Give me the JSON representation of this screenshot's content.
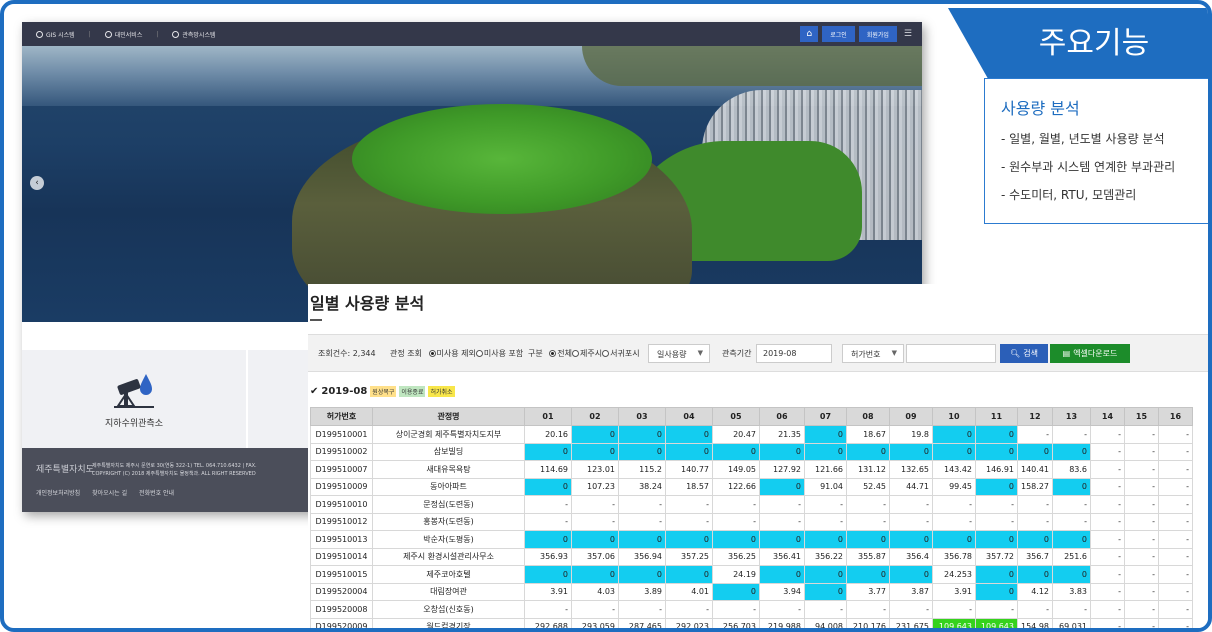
{
  "site": {
    "topbar": {
      "menu": [
        "GIS 시스템",
        "대민서비스",
        "관측망시스템"
      ],
      "login": "로그인",
      "signup": "회원가입"
    },
    "quick_card_label": "지하수위관측소",
    "footer": {
      "logo": "제주특별자치도",
      "info_line1": "제주특별자치도 제주시 문연로 30(연동 322-1) TEL. 064.710.6432 | FAX.",
      "info_line2": "COPYRIGHT (C) 2018 제주특별자치도 물정책과. ALL RIGHT RESERVED",
      "links": [
        "개인정보처리방침",
        "찾아오시는 길",
        "전화번호 안내"
      ]
    }
  },
  "feature": {
    "title": "주요기능",
    "heading": "사용량 분석",
    "items": [
      "- 일별, 월별, 년도별 사용량 분석",
      "- 원수부과 시스템 연계한 부과관리",
      "- 수도미터, RTU, 모뎀관리"
    ]
  },
  "panel": {
    "title": "일별 사용량 분석",
    "filter": {
      "count_label": "조회건수:",
      "count_value": "2,344",
      "query_label": "관정 조회",
      "query_opt1": "미사용 제외",
      "query_opt2": "미사용 포함",
      "region_label": "구분",
      "region_opt1": "전체",
      "region_opt2": "제주시",
      "region_opt3": "서귀포시",
      "usage_select": "일사용량",
      "period_label": "관측기간",
      "period_value": "2019-08",
      "permit_select": "허가번호",
      "search_button": "검색",
      "excel_button": "엑셀다운로드"
    },
    "period_heading": "2019-08",
    "legend": {
      "normal": "원상복구",
      "end": "이용종료",
      "cancel": "허가취소"
    },
    "columns": [
      "허가번호",
      "관정명",
      "01",
      "02",
      "03",
      "04",
      "05",
      "06",
      "07",
      "08",
      "09",
      "10",
      "11",
      "12",
      "13",
      "14",
      "15",
      "16"
    ],
    "rows": [
      {
        "id": "D199510001",
        "name": "상이군경회 제주특별자치도지부",
        "values": [
          "20.16",
          "0",
          "0",
          "0",
          "20.47",
          "21.35",
          "0",
          "18.67",
          "19.8",
          "0",
          "0",
          "-",
          "-",
          "-",
          "-",
          "-"
        ]
      },
      {
        "id": "D199510002",
        "name": "삼보빌딩",
        "values": [
          "0",
          "0",
          "0",
          "0",
          "0",
          "0",
          "0",
          "0",
          "0",
          "0",
          "0",
          "0",
          "0",
          "-",
          "-",
          "-"
        ]
      },
      {
        "id": "D199510007",
        "name": "새대유목욕탕",
        "values": [
          "114.69",
          "123.01",
          "115.2",
          "140.77",
          "149.05",
          "127.92",
          "121.66",
          "131.12",
          "132.65",
          "143.42",
          "146.91",
          "140.41",
          "83.6",
          "-",
          "-",
          "-"
        ]
      },
      {
        "id": "D199510009",
        "name": "동아아파트",
        "values": [
          "0",
          "107.23",
          "38.24",
          "18.57",
          "122.66",
          "0",
          "91.04",
          "52.45",
          "44.71",
          "99.45",
          "0",
          "158.27",
          "0",
          "-",
          "-",
          "-"
        ]
      },
      {
        "id": "D199510010",
        "name": "문정심(도련동)",
        "values": [
          "-",
          "-",
          "-",
          "-",
          "-",
          "-",
          "-",
          "-",
          "-",
          "-",
          "-",
          "-",
          "-",
          "-",
          "-",
          "-"
        ]
      },
      {
        "id": "D199510012",
        "name": "홍봉자(도련동)",
        "values": [
          "-",
          "-",
          "-",
          "-",
          "-",
          "-",
          "-",
          "-",
          "-",
          "-",
          "-",
          "-",
          "-",
          "-",
          "-",
          "-"
        ]
      },
      {
        "id": "D199510013",
        "name": "박순자(도평동)",
        "values": [
          "0",
          "0",
          "0",
          "0",
          "0",
          "0",
          "0",
          "0",
          "0",
          "0",
          "0",
          "0",
          "0",
          "-",
          "-",
          "-"
        ]
      },
      {
        "id": "D199510014",
        "name": "제주시 환경시설관리사무소",
        "values": [
          "356.93",
          "357.06",
          "356.94",
          "357.25",
          "356.25",
          "356.41",
          "356.22",
          "355.87",
          "356.4",
          "356.78",
          "357.72",
          "356.7",
          "251.6",
          "-",
          "-",
          "-"
        ]
      },
      {
        "id": "D199510015",
        "name": "제주코아호텔",
        "values": [
          "0",
          "0",
          "0",
          "0",
          "24.19",
          "0",
          "0",
          "0",
          "0",
          "24.253",
          "0",
          "0",
          "0",
          "-",
          "-",
          "-"
        ]
      },
      {
        "id": "D199520004",
        "name": "대림장여관",
        "values": [
          "3.91",
          "4.03",
          "3.89",
          "4.01",
          "0",
          "3.94",
          "0",
          "3.77",
          "3.87",
          "3.91",
          "0",
          "4.12",
          "3.83",
          "-",
          "-",
          "-"
        ]
      },
      {
        "id": "D199520008",
        "name": "오창섭(신호동)",
        "values": [
          "-",
          "-",
          "-",
          "-",
          "-",
          "-",
          "-",
          "-",
          "-",
          "-",
          "-",
          "-",
          "-",
          "-",
          "-",
          "-"
        ]
      },
      {
        "id": "D199520009",
        "name": "월드컵경기장",
        "values": [
          "292.688",
          "293.059",
          "287.465",
          "292.023",
          "256.703",
          "219.988",
          "94.008",
          "210.176",
          "231.675",
          "109.643",
          "109.643",
          "154.98",
          "69.031",
          "-",
          "-",
          "-"
        ]
      }
    ],
    "highlight_colors": {
      "zero": "#13cdf0",
      "flag": "#35d21c"
    }
  }
}
